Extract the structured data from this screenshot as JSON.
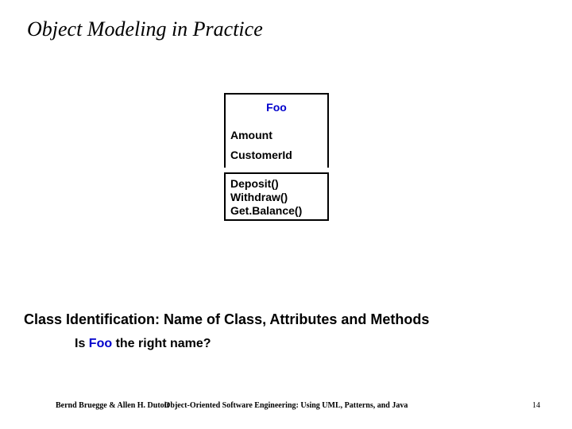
{
  "title": "Object Modeling in Practice",
  "uml": {
    "class_name": "Foo",
    "attributes": [
      "Amount",
      "CustomerId"
    ],
    "operations": [
      "Deposit()",
      "Withdraw()",
      "Get.Balance()"
    ]
  },
  "subheading": "Class Identification: Name of Class, Attributes and Methods",
  "question_prefix": "Is ",
  "question_highlight": "Foo",
  "question_suffix": " the right name?",
  "footer": {
    "left": "Bernd Bruegge & Allen H. Dutoit",
    "center": "Object-Oriented Software Engineering: Using UML, Patterns, and Java",
    "page": "14"
  }
}
